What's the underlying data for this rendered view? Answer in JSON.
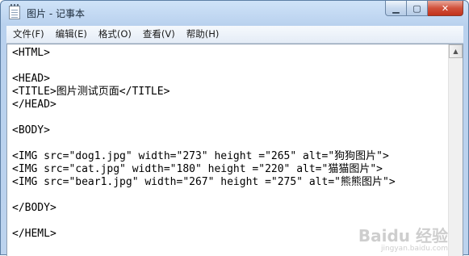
{
  "window": {
    "title": "图片 - 记事本",
    "buttons": {
      "minimize": "▁",
      "maximize": "▢",
      "close": "✕"
    }
  },
  "menu": {
    "items": [
      "文件(F)",
      "编辑(E)",
      "格式(O)",
      "查看(V)",
      "帮助(H)"
    ]
  },
  "editor": {
    "content": "<HTML>\n\n<HEAD>\n<TITLE>图片测试页面</TITLE>\n</HEAD>\n\n<BODY>\n\n<IMG src=\"dog1.jpg\" width=\"273\" height =\"265\" alt=\"狗狗图片\">\n<IMG src=\"cat.jpg\" width=\"180\" height =\"220\" alt=\"猫猫图片\">\n<IMG src=\"bear1.jpg\" width=\"267\" height =\"275\" alt=\"熊熊图片\">\n\n</BODY>\n\n</HEML>"
  },
  "scrollbar": {
    "up_arrow": "▲"
  },
  "watermark": {
    "main": "Baidu 经验",
    "sub": "jingyan.baidu.com"
  }
}
